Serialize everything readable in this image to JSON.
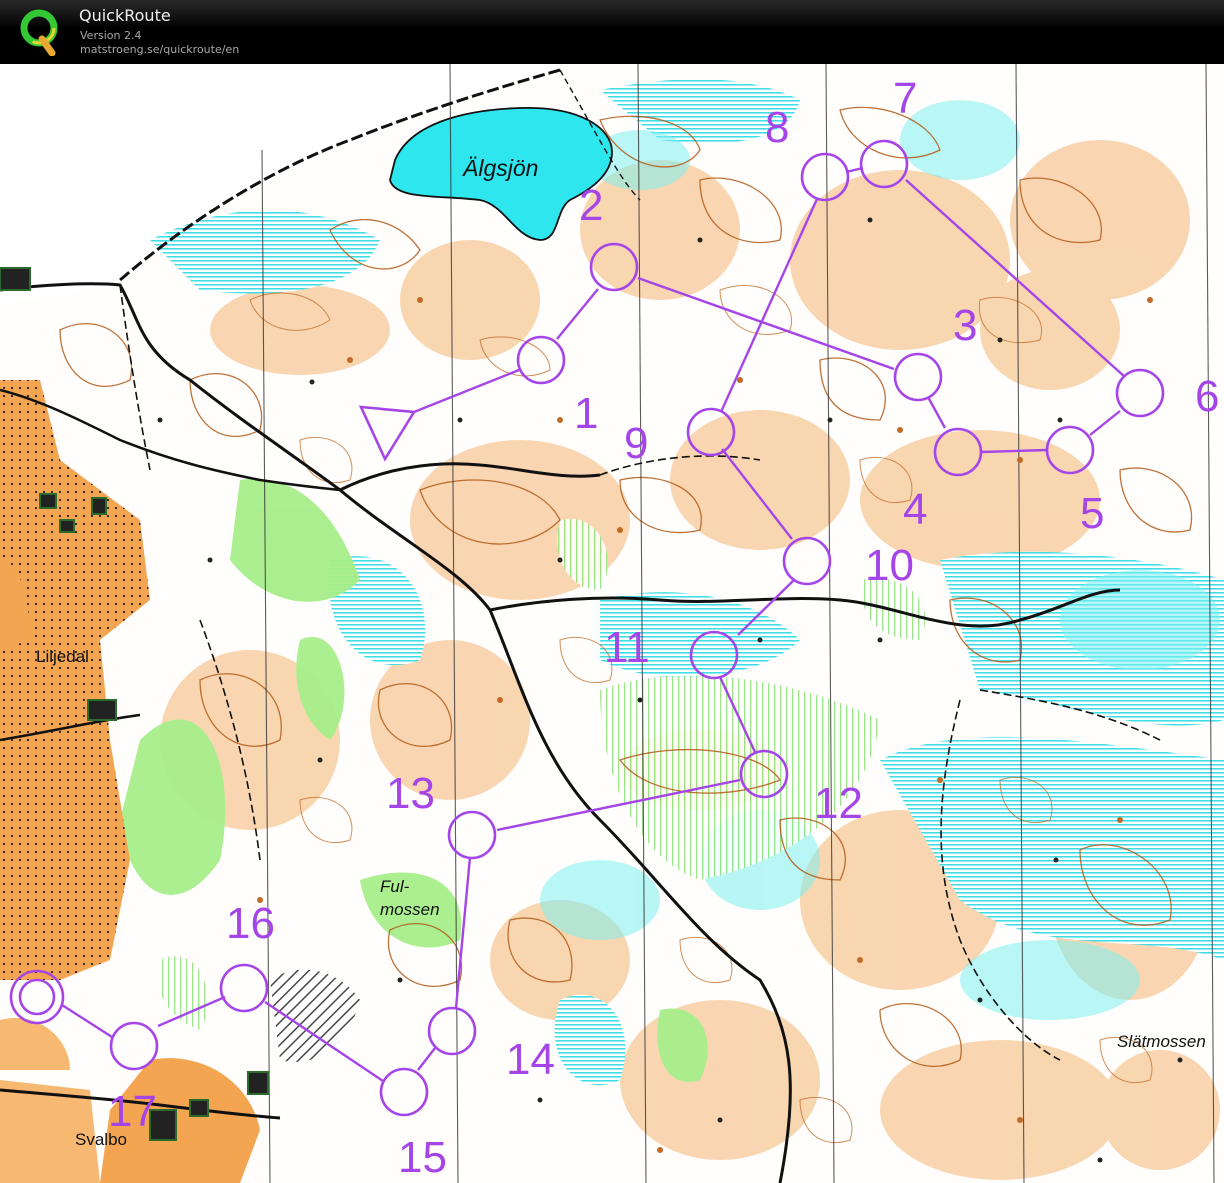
{
  "app": {
    "title": "QuickRoute",
    "version": "Version 2.4",
    "url": "matstroeng.se/quickroute/en"
  },
  "map": {
    "place_labels": {
      "algsjon": "Älgsjön",
      "liljedal": "Liljedal",
      "fulmossen_1": "Ful-",
      "fulmossen_2": "mossen",
      "slatmossen": "Slätmossen",
      "svalbo": "Svalbo"
    },
    "controls": [
      "1",
      "2",
      "3",
      "4",
      "5",
      "6",
      "7",
      "8",
      "9",
      "10",
      "11",
      "12",
      "13",
      "14",
      "15",
      "16",
      "17"
    ],
    "colors": {
      "course": "#a545e8",
      "open_land": "#f5c79a",
      "field": "#f4a552",
      "water": "#3ee3ec",
      "green": "#9fea80",
      "marsh": "#40dfe8",
      "contour": "#b35a18",
      "magnetic_line": "#222222"
    }
  }
}
